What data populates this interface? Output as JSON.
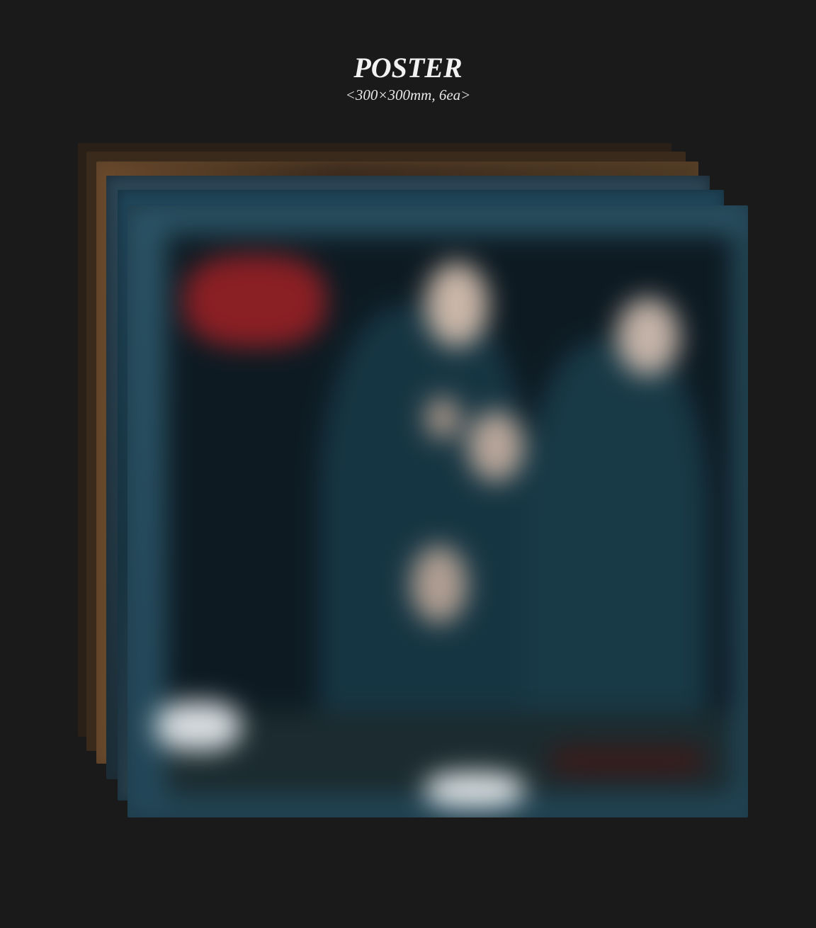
{
  "header": {
    "title": "POSTER",
    "subtitle": "<300×300mm, 6ea>"
  },
  "colors": {
    "background": "#1a1a1a",
    "text": "#f2f2f2"
  }
}
